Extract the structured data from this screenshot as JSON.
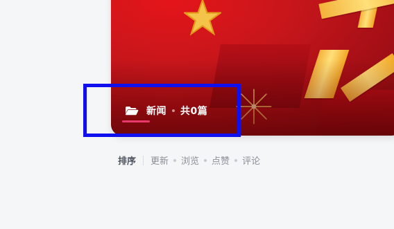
{
  "category": {
    "name": "新闻",
    "count_text": "共0篇",
    "icon": "folder-open-icon"
  },
  "sort": {
    "label": "排序",
    "options": [
      "更新",
      "浏览",
      "点赞",
      "评论"
    ]
  },
  "colors": {
    "banner_red": "#c7161b",
    "accent_underline": "#e83a6b",
    "annotation_blue": "#1010ee",
    "page_bg": "#f5f6f8"
  }
}
